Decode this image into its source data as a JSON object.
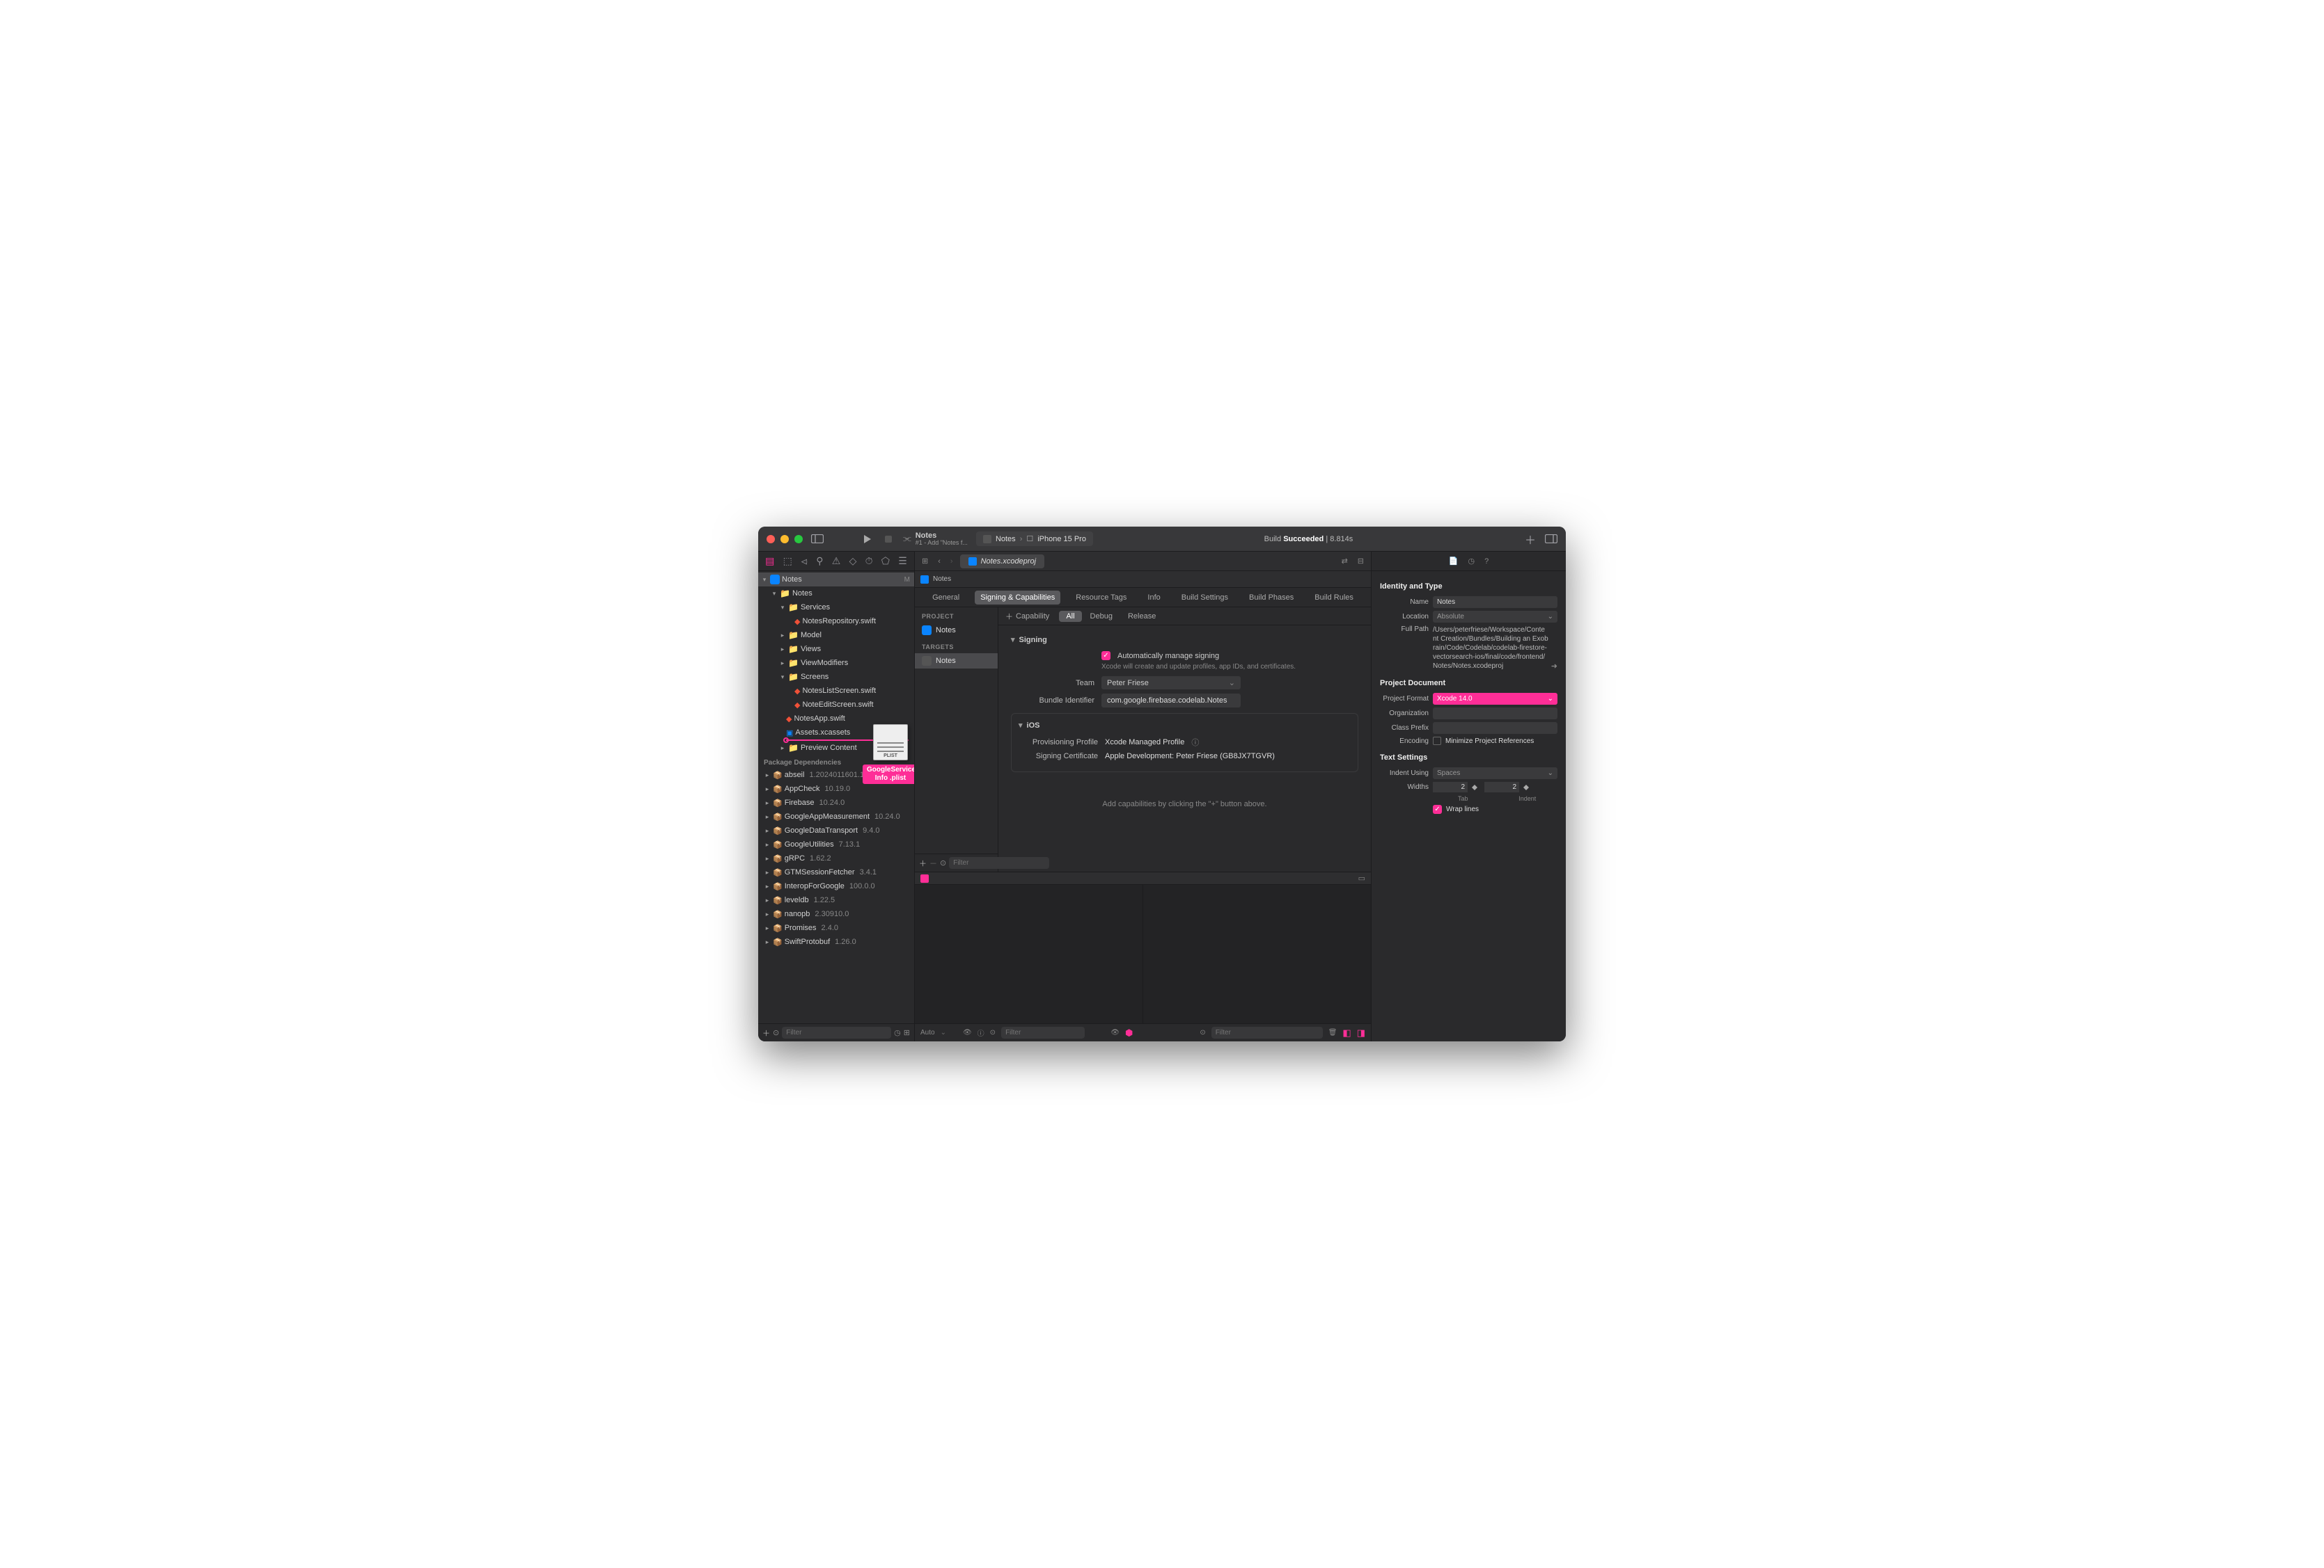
{
  "titlebar": {
    "scheme_title": "Notes",
    "scheme_sub": "#1 - Add \"Notes f...",
    "scheme_target": "Notes",
    "device": "iPhone 15 Pro",
    "build_prefix": "Build",
    "build_status": "Succeeded",
    "build_time": "8.814s"
  },
  "tabbar": {
    "active_tab": "Notes.xcodeproj"
  },
  "jumpbar": {
    "item": "Notes"
  },
  "navigator": {
    "project_name": "Notes",
    "badge": "M",
    "tree": {
      "root_folder": "Notes",
      "services": "Services",
      "services_file": "NotesRepository.swift",
      "model": "Model",
      "views": "Views",
      "viewmodifiers": "ViewModifiers",
      "screens": "Screens",
      "screens_files": [
        "NotesListScreen.swift",
        "NoteEditScreen.swift"
      ],
      "app_file": "NotesApp.swift",
      "assets": "Assets.xcassets",
      "preview": "Preview Content"
    },
    "package_header": "Package Dependencies",
    "packages": [
      {
        "name": "abseil",
        "ver": "1.2024011601.1"
      },
      {
        "name": "AppCheck",
        "ver": "10.19.0"
      },
      {
        "name": "Firebase",
        "ver": "10.24.0"
      },
      {
        "name": "GoogleAppMeasurement",
        "ver": "10.24.0"
      },
      {
        "name": "GoogleDataTransport",
        "ver": "9.4.0"
      },
      {
        "name": "GoogleUtilities",
        "ver": "7.13.1"
      },
      {
        "name": "gRPC",
        "ver": "1.62.2"
      },
      {
        "name": "GTMSessionFetcher",
        "ver": "3.4.1"
      },
      {
        "name": "InteropForGoogle",
        "ver": "100.0.0"
      },
      {
        "name": "leveldb",
        "ver": "1.22.5"
      },
      {
        "name": "nanopb",
        "ver": "2.30910.0"
      },
      {
        "name": "Promises",
        "ver": "2.4.0"
      },
      {
        "name": "SwiftProtobuf",
        "ver": "1.26.0"
      }
    ],
    "dragged_label": "PLIST",
    "dragged_name": "GoogleService-Info .plist",
    "filter_placeholder": "Filter"
  },
  "project_tabs": {
    "general": "General",
    "signing": "Signing & Capabilities",
    "resource": "Resource Tags",
    "info": "Info",
    "build_settings": "Build Settings",
    "build_phases": "Build Phases",
    "build_rules": "Build Rules"
  },
  "targets": {
    "project_label": "PROJECT",
    "project_item": "Notes",
    "targets_label": "TARGETS",
    "target_item": "Notes",
    "filter_placeholder": "Filter"
  },
  "signing": {
    "capability_btn": "Capability",
    "scopes": [
      "All",
      "Debug",
      "Release"
    ],
    "header": "Signing",
    "auto_label": "Automatically manage signing",
    "auto_help": "Xcode will create and update profiles, app IDs, and certificates.",
    "team_label": "Team",
    "team_value": "Peter Friese",
    "bundle_label": "Bundle Identifier",
    "bundle_value": "com.google.firebase.codelab.Notes",
    "ios_header": "iOS",
    "prov_label": "Provisioning Profile",
    "prov_value": "Xcode Managed Profile",
    "cert_label": "Signing Certificate",
    "cert_value": "Apple Development: Peter Friese (GB8JX7TGVR)",
    "empty_hint": "Add capabilities by clicking the \"+\" button above."
  },
  "inspector": {
    "identity_title": "Identity and Type",
    "name_label": "Name",
    "name_value": "Notes",
    "location_label": "Location",
    "location_value": "Absolute",
    "fullpath_label": "Full Path",
    "fullpath_value": "/Users/peterfriese/Workspace/Content Creation/Bundles/Building an Exobrain/Code/Codelab/codelab-firestore-vectorsearch-ios/final/code/frontend/Notes/Notes.xcodeproj",
    "project_doc_title": "Project Document",
    "format_label": "Project Format",
    "format_value": "Xcode 14.0",
    "org_label": "Organization",
    "prefix_label": "Class Prefix",
    "encoding_label": "Encoding",
    "minimize_label": "Minimize Project References",
    "text_title": "Text Settings",
    "indent_label": "Indent Using",
    "indent_value": "Spaces",
    "widths_label": "Widths",
    "tab_value": "2",
    "tab_caption": "Tab",
    "indent_value2": "2",
    "indent_caption": "Indent",
    "wrap_label": "Wrap lines"
  },
  "debug": {
    "auto": "Auto",
    "filter_placeholder": "Filter"
  }
}
